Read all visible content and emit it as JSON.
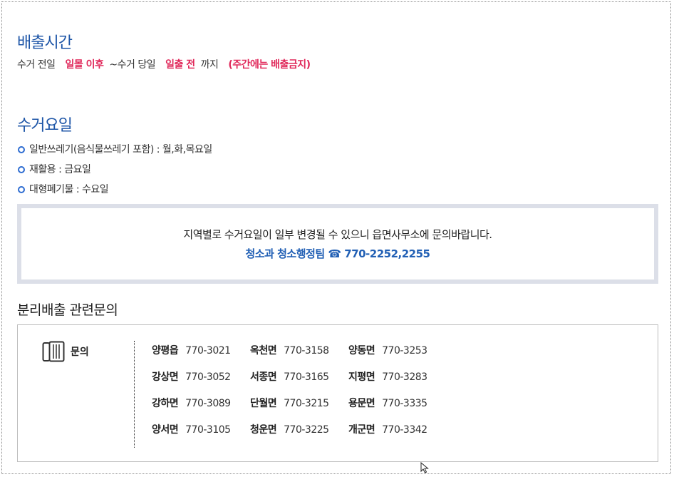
{
  "schedule": {
    "title": "배출시간",
    "parts": [
      {
        "text": "수거 전일",
        "highlight": false
      },
      {
        "text": "일몰 이후",
        "highlight": true
      },
      {
        "text": "~수거 당일",
        "highlight": false
      },
      {
        "text": "일출 전",
        "highlight": true
      },
      {
        "text": "까지",
        "highlight": false
      },
      {
        "text": "(주간에는 배출금지)",
        "highlight": true
      }
    ],
    "highlight_color": "#e0285a"
  },
  "collection": {
    "title": "수거요일",
    "items": [
      "일반쓰레기(음식물쓰레기 포함) : 월,화,목요일",
      "재활용 : 금요일",
      "대형폐기물 : 수요일"
    ],
    "bullet_icon": "circle-bullet-icon"
  },
  "notice": {
    "line1": "지역별로 수거요일이 일부 변경될 수 있으니 읍면사무소에 문의바랍니다.",
    "line2": "청소과 청소행정팀 ☎ 770-2252,2255",
    "accent_color": "#2260b5"
  },
  "inquiry": {
    "title": "분리배출 관련문의",
    "label": "문의",
    "icon": "phone-icon",
    "rows": [
      [
        {
          "town": "양평읍",
          "number": "770-3021"
        },
        {
          "town": "옥천면",
          "number": "770-3158"
        },
        {
          "town": "양동면",
          "number": "770-3253"
        }
      ],
      [
        {
          "town": "강상면",
          "number": "770-3052"
        },
        {
          "town": "서종면",
          "number": "770-3165"
        },
        {
          "town": "지평면",
          "number": "770-3283"
        }
      ],
      [
        {
          "town": "강하면",
          "number": "770-3089"
        },
        {
          "town": "단월면",
          "number": "770-3215"
        },
        {
          "town": "용문면",
          "number": "770-3335"
        }
      ],
      [
        {
          "town": "양서면",
          "number": "770-3105"
        },
        {
          "town": "청운면",
          "number": "770-3225"
        },
        {
          "town": "개군면",
          "number": "770-3342"
        }
      ]
    ]
  },
  "colors": {
    "title_blue": "#1d55a7",
    "notice_border": "#dcdfe8"
  }
}
